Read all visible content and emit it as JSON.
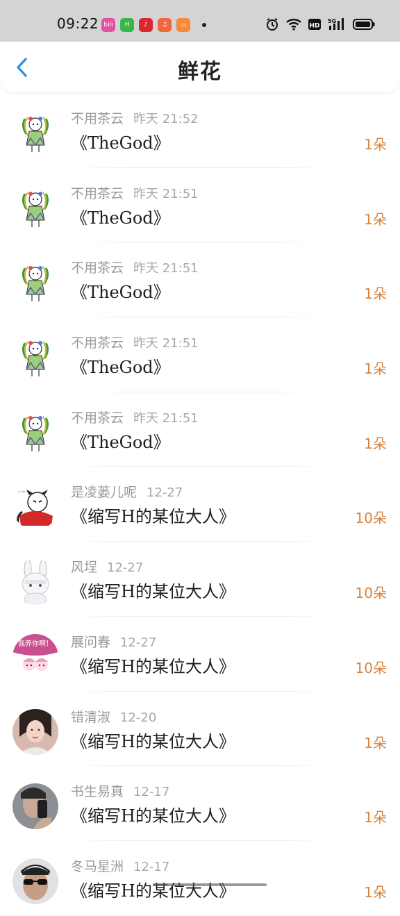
{
  "status_bar": {
    "time": "09:22",
    "app_icons": [
      {
        "name": "bilibili-app-icon",
        "color": "#e052a1",
        "text": "bili"
      },
      {
        "name": "green-app-icon",
        "color": "#3bb54a",
        "text": "H"
      },
      {
        "name": "red-app-icon",
        "color": "#d9282f",
        "text": "♪"
      },
      {
        "name": "music-app-icon",
        "color": "#f2663f",
        "text": "♫"
      },
      {
        "name": "orange-app-icon",
        "color": "#f5893a",
        "text": "▭"
      }
    ],
    "network": "5G"
  },
  "header": {
    "title": "鲜花"
  },
  "gifts": [
    {
      "name": "不用茶云",
      "time": "昨天 21:52",
      "book": "《TheGod》",
      "count": "1朵",
      "avatar": "doll"
    },
    {
      "name": "不用茶云",
      "time": "昨天 21:51",
      "book": "《TheGod》",
      "count": "1朵",
      "avatar": "doll"
    },
    {
      "name": "不用茶云",
      "time": "昨天 21:51",
      "book": "《TheGod》",
      "count": "1朵",
      "avatar": "doll"
    },
    {
      "name": "不用茶云",
      "time": "昨天 21:51",
      "book": "《TheGod》",
      "count": "1朵",
      "avatar": "doll"
    },
    {
      "name": "不用茶云",
      "time": "昨天 21:51",
      "book": "《TheGod》",
      "count": "1朵",
      "avatar": "doll"
    },
    {
      "name": "是凌蒌儿呢",
      "time": "12-27",
      "book": "《缩写H的某位大人》",
      "count": "10朵",
      "avatar": "redcat"
    },
    {
      "name": "风埕",
      "time": "12-27",
      "book": "《缩写H的某位大人》",
      "count": "10朵",
      "avatar": "rabbit"
    },
    {
      "name": "展问春",
      "time": "12-27",
      "book": "《缩写H的某位大人》",
      "count": "10朵",
      "avatar": "pinkbadge",
      "avatar_text": "我养你啊！"
    },
    {
      "name": "错清淑",
      "time": "12-20",
      "book": "《缩写H的某位大人》",
      "count": "1朵",
      "avatar": "girl"
    },
    {
      "name": "书生易真",
      "time": "12-17",
      "book": "《缩写H的某位大人》",
      "count": "1朵",
      "avatar": "phone"
    },
    {
      "name": "冬马星洲",
      "time": "12-17",
      "book": "《缩写H的某位大人》",
      "count": "1朵",
      "avatar": "sunglasses"
    }
  ],
  "colors": {
    "accent_blue": "#2a8fe0",
    "count_orange": "#d9823b",
    "status_bar_bg": "#d4d4d4"
  }
}
